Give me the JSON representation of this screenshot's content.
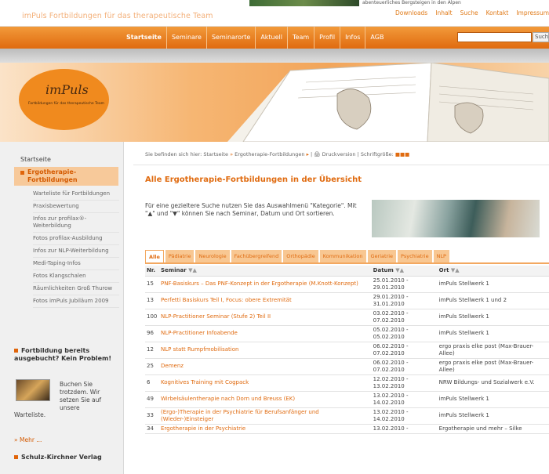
{
  "top": {
    "caption": "abenteuerliches Bergsteigen in den Alpen"
  },
  "header": {
    "site_title": "imPuls Fortbildungen für das therapeutische Team",
    "util_links": [
      "Downloads",
      "Inhalt",
      "Suche",
      "Kontakt",
      "Impressum"
    ]
  },
  "nav": {
    "items": [
      "Startseite",
      "Seminare",
      "Seminarorte",
      "Aktuell",
      "Team",
      "Profil",
      "Infos",
      "AGB"
    ],
    "search_button": "Suche"
  },
  "banner": {
    "logo": "imPuls",
    "logo_tagline": "Fortbildungen für das therapeutische Team"
  },
  "sidebar": {
    "home": "Startseite",
    "active": "Ergotherapie-Fortbildungen",
    "sub_items": [
      "Warteliste für Fortbildungen",
      "Praxisbewertung",
      "Infos zur profilax®-Weiterbildung",
      "Fotos profilax-Ausbildung",
      "Infos zur NLP-Weiterbildung",
      "Medi-Taping-Infos",
      "Fotos Klangschalen",
      "Räumlichkeiten Groß Thurow",
      "Fotos imPuls Jubiläum 2009"
    ],
    "box_title": "Fortbildung bereits ausgebucht? Kein Problem!",
    "box_text": "Buchen Sie trotzdem. Wir setzen Sie auf unsere",
    "box_text2": "Warteliste.",
    "more": "Mehr ...",
    "box2_title": "Schulz-Kirchner Verlag"
  },
  "main": {
    "breadcrumb": {
      "prefix": "Sie befinden sich hier:",
      "home": "Startseite",
      "current": "Ergotherapie-Fortbildungen",
      "print": "Druckversion",
      "fontsize": "Schriftgröße:"
    },
    "title": "Alle Ergotherapie-Fortbildungen in der Übersicht",
    "intro": "Für eine gezieltere Suche nutzen Sie das Auswahlmenü \"Kategorie\". Mit \"▲\" und \"▼\" können Sie nach Seminar, Datum und Ort sortieren.",
    "tabs": [
      "Alle",
      "Pädiatrie",
      "Neurologie",
      "Fachübergreifend",
      "Orthopädie",
      "Kommunikation",
      "Geriatrie",
      "Psychiatrie",
      "NLP"
    ],
    "columns": [
      "Nr.",
      "Seminar",
      "Datum",
      "Ort"
    ],
    "rows": [
      {
        "nr": "15",
        "seminar": "PNF-Basiskurs – Das PNF-Konzept in der Ergotherapie (M.Knott-Konzept)",
        "datum": "25.01.2010 - 29.01.2010",
        "ort": "imPuls Stellwerk 1"
      },
      {
        "nr": "13",
        "seminar": "Perfetti Basiskurs Teil I, Focus: obere Extremität",
        "datum": "29.01.2010 - 31.01.2010",
        "ort": "imPuls Stellwerk 1 und 2"
      },
      {
        "nr": "100",
        "seminar": "NLP-Practitioner Seminar (Stufe 2) Teil II",
        "datum": "03.02.2010 - 07.02.2010",
        "ort": "imPuls Stellwerk 1"
      },
      {
        "nr": "96",
        "seminar": "NLP-Practitioner Infoabende",
        "datum": "05.02.2010 - 05.02.2010",
        "ort": "imPuls Stellwerk 1"
      },
      {
        "nr": "12",
        "seminar": "NLP statt Rumpfmobilisation",
        "datum": "06.02.2010 - 07.02.2010",
        "ort": "ergo praxis elke post (Max-Brauer-Allee)"
      },
      {
        "nr": "25",
        "seminar": "Demenz",
        "datum": "06.02.2010 - 07.02.2010",
        "ort": "ergo praxis elke post (Max-Brauer-Allee)"
      },
      {
        "nr": "6",
        "seminar": "Kognitives Training mit Cogpack",
        "datum": "12.02.2010 - 13.02.2010",
        "ort": "NRW Bildungs- und Sozialwerk e.V."
      },
      {
        "nr": "49",
        "seminar": "Wirbelsäulentherapie nach Dorn und Breuss (EK)",
        "datum": "13.02.2010 - 14.02.2010",
        "ort": "imPuls Stellwerk 1"
      },
      {
        "nr": "33",
        "seminar": "(Ergo-)Therapie in der Psychiatrie für Berufsanfänger und (Wieder-)Einsteiger",
        "datum": "13.02.2010 - 14.02.2010",
        "ort": "imPuls Stellwerk 1"
      },
      {
        "nr": "34",
        "seminar": "Ergotherapie in der Psychiatrie",
        "datum": "13.02.2010 -",
        "ort": "Ergotherapie und mehr – Silke"
      }
    ]
  }
}
